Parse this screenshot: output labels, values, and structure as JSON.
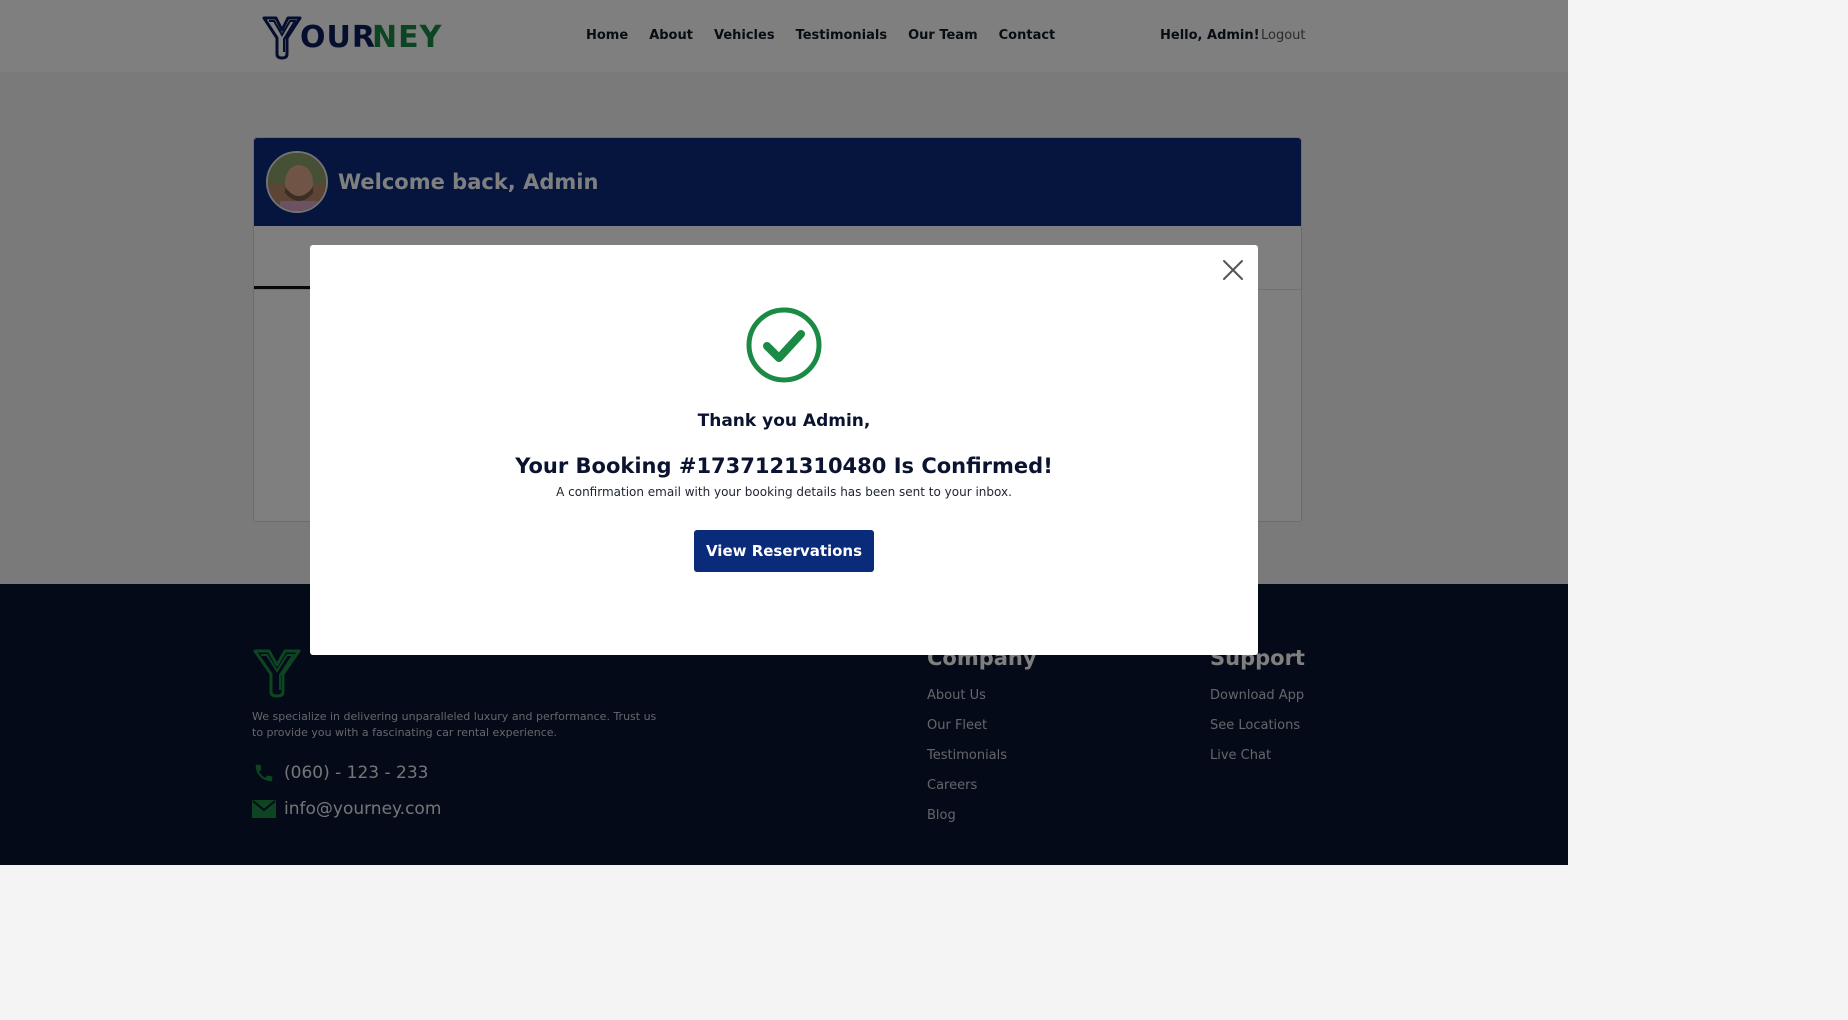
{
  "brand": {
    "logo_part1": "OUR",
    "logo_part2": "NEY",
    "navy": "#0b1e5b",
    "green": "#1b8a45"
  },
  "nav": {
    "items": [
      {
        "label": "Home"
      },
      {
        "label": "About"
      },
      {
        "label": "Vehicles"
      },
      {
        "label": "Testimonials"
      },
      {
        "label": "Our Team"
      },
      {
        "label": "Contact"
      }
    ],
    "greeting": "Hello, Admin!",
    "logout": "Logout"
  },
  "dashboard": {
    "welcome": "Welcome back, Admin"
  },
  "modal": {
    "thanks": "Thank you Admin,",
    "booking": "Your Booking #1737121310480 Is Confirmed!",
    "confirmation": "A confirmation email with your booking details has been sent to your inbox.",
    "button": "View Reservations",
    "icons": [
      "check-circle-icon",
      "close-icon"
    ]
  },
  "footer": {
    "description": "We specialize in delivering unparalleled luxury and performance. Trust us to provide you with a fascinating car rental experience.",
    "phone": "(060) - 123 - 233",
    "email": "info@yourney.com",
    "company": {
      "title": "Company",
      "links": [
        {
          "label": "About Us"
        },
        {
          "label": "Our Fleet"
        },
        {
          "label": "Testimonials"
        },
        {
          "label": "Careers"
        },
        {
          "label": "Blog"
        }
      ]
    },
    "support": {
      "title": "Support",
      "links": [
        {
          "label": "Download App"
        },
        {
          "label": "See Locations"
        },
        {
          "label": "Live Chat"
        }
      ]
    }
  }
}
